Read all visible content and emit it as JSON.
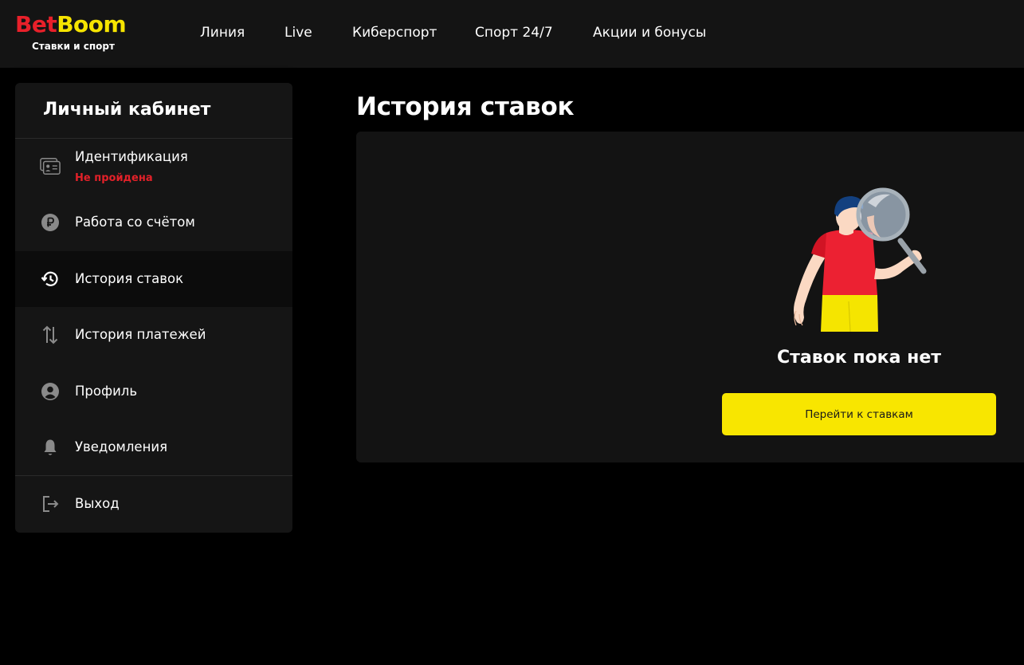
{
  "brand": {
    "name_part1": "Bet",
    "name_part2": "Boom",
    "tagline": "Ставки и спорт",
    "color_primary": "#e8202a",
    "color_accent": "#f6e400"
  },
  "nav": {
    "items": [
      {
        "label": "Линия"
      },
      {
        "label": "Live"
      },
      {
        "label": "Киберспорт"
      },
      {
        "label": "Спорт 24/7"
      },
      {
        "label": "Акции и бонусы"
      }
    ]
  },
  "sidebar": {
    "title": "Личный кабинет",
    "items": [
      {
        "label": "Идентификация",
        "status": "Не пройдена",
        "icon": "id-card-icon"
      },
      {
        "label": "Работа со счётом",
        "icon": "ruble-coin-icon"
      },
      {
        "label": "История ставок",
        "icon": "history-icon",
        "active": true
      },
      {
        "label": "История платежей",
        "icon": "transfer-arrows-icon"
      },
      {
        "label": "Профиль",
        "icon": "user-circle-icon"
      },
      {
        "label": "Уведомления",
        "icon": "bell-icon"
      },
      {
        "label": "Выход",
        "icon": "logout-icon"
      }
    ]
  },
  "main": {
    "title": "История ставок",
    "empty_state": {
      "illustration": "person-with-magnifier",
      "title": "Ставок пока нет",
      "button_label": "Перейти к ставкам",
      "button_color": "#f8e600"
    }
  }
}
